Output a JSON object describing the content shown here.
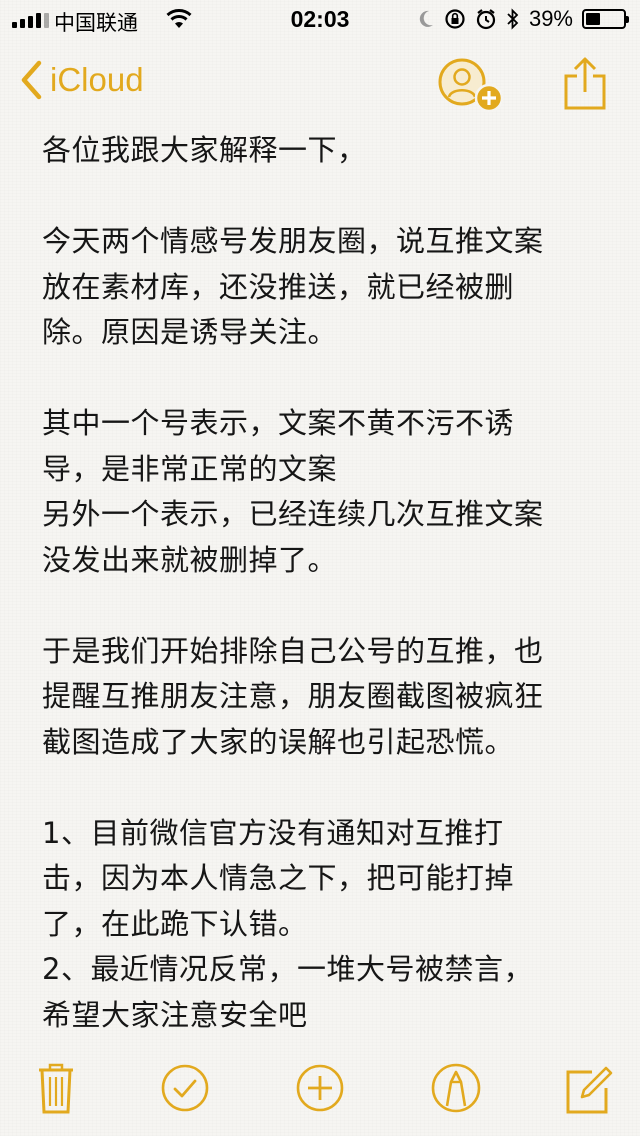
{
  "status_bar": {
    "carrier": "中国联通",
    "time": "02:03",
    "battery_percent": "39%",
    "battery_level": 0.39
  },
  "nav": {
    "back_label": "iCloud"
  },
  "note": {
    "lines": [
      "各位我跟大家解释一下，",
      "",
      "今天两个情感号发朋友圈，说互推文案",
      "放在素材库，还没推送，就已经被删",
      "除。原因是诱导关注。",
      "",
      "其中一个号表示，文案不黄不污不诱",
      "导，是非常正常的文案",
      "另外一个表示，已经连续几次互推文案",
      "没发出来就被删掉了。",
      "",
      "于是我们开始排除自己公号的互推，也",
      "提醒互推朋友注意，朋友圈截图被疯狂",
      "截图造成了大家的误解也引起恐慌。",
      "",
      "1、目前微信官方没有通知对互推打",
      "击，因为本人情急之下，把可能打掉",
      "了，在此跪下认错。",
      "2、最近情况反常，一堆大号被禁言，",
      "希望大家注意安全吧"
    ]
  },
  "colors": {
    "accent": "#e2a91e",
    "background": "#f6f5f2",
    "text": "#161616"
  },
  "icons": [
    "back-chevron-icon",
    "add-person-icon",
    "share-icon",
    "trash-icon",
    "checklist-icon",
    "add-icon",
    "markup-pen-icon",
    "compose-icon"
  ]
}
